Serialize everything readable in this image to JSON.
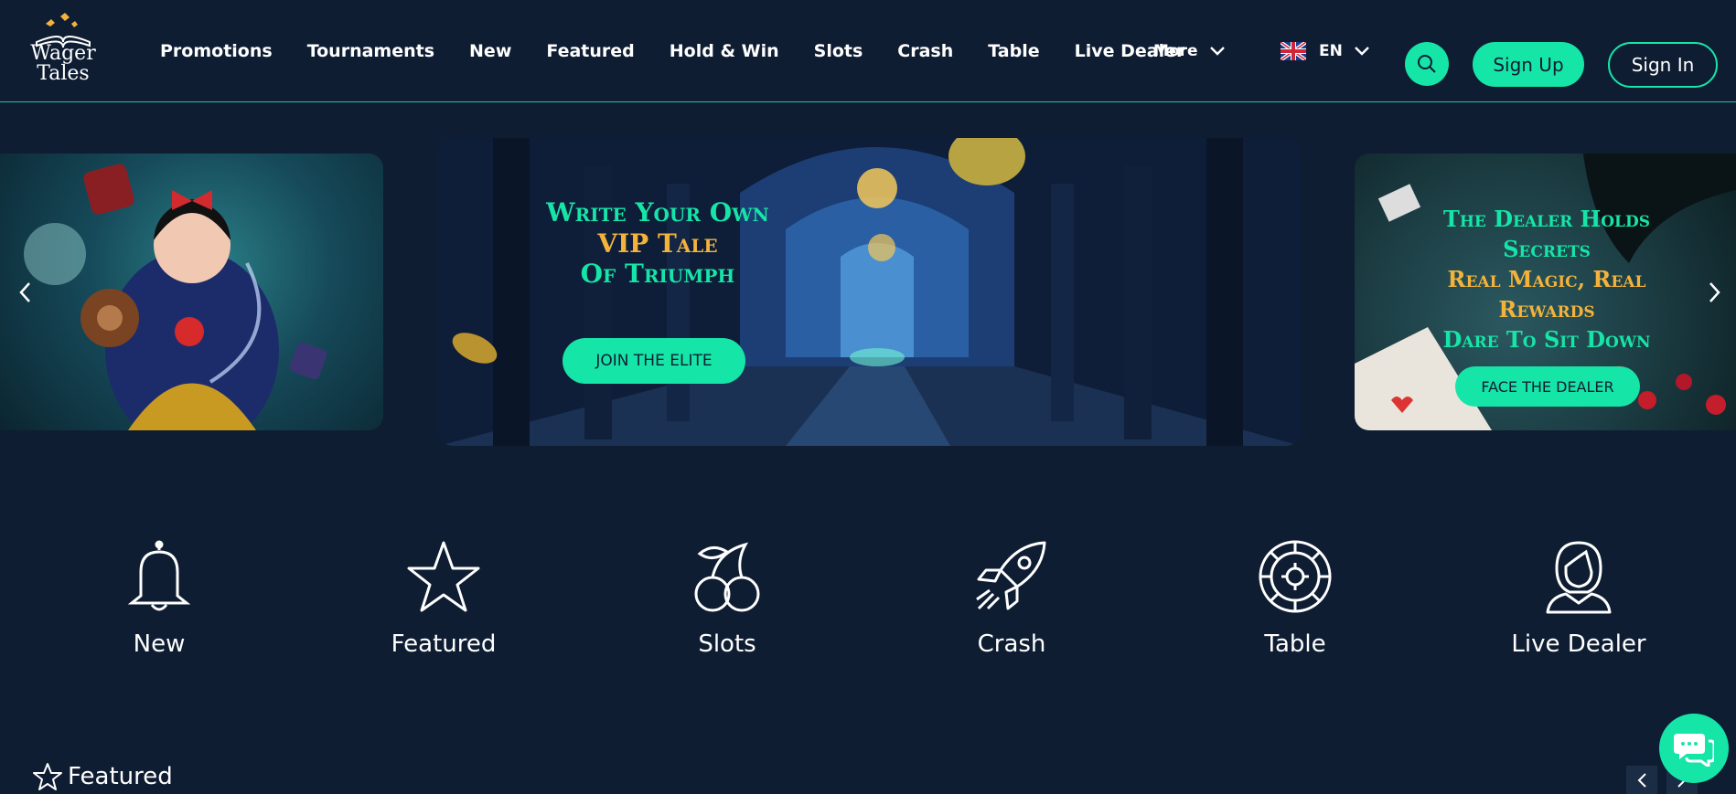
{
  "logo": {
    "line1": "Wager",
    "line2": "Tales"
  },
  "nav": {
    "items": [
      "Promotions",
      "Tournaments",
      "New",
      "Featured",
      "Hold & Win",
      "Slots",
      "Crash",
      "Table",
      "Live Dealer"
    ],
    "more_label": "More"
  },
  "language": {
    "code": "EN",
    "flag_icon": "uk-flag-icon"
  },
  "header_buttons": {
    "signup": "Sign Up",
    "signin": "Sign In"
  },
  "carousel": {
    "center": {
      "line1": "Write Your Own",
      "line2": "VIP Tale",
      "line3": "Of Triumph",
      "cta": "JOIN THE ELITE"
    },
    "right": {
      "line1": "The Dealer Holds",
      "line2": "Secrets",
      "line3": "Real Magic, Real",
      "line4": "Rewards",
      "line5": "Dare To Sit Down",
      "cta": "FACE THE DEALER"
    }
  },
  "categories": [
    {
      "label": "New",
      "icon": "bell-icon"
    },
    {
      "label": "Featured",
      "icon": "star-icon"
    },
    {
      "label": "Slots",
      "icon": "cherries-icon"
    },
    {
      "label": "Crash",
      "icon": "rocket-icon"
    },
    {
      "label": "Table",
      "icon": "roulette-icon"
    },
    {
      "label": "Live Dealer",
      "icon": "dealer-icon"
    }
  ],
  "featured_section": {
    "title": "Featured"
  },
  "colors": {
    "background": "#0f1d33",
    "accent": "#16e5a8",
    "gold": "#f3b33b"
  }
}
